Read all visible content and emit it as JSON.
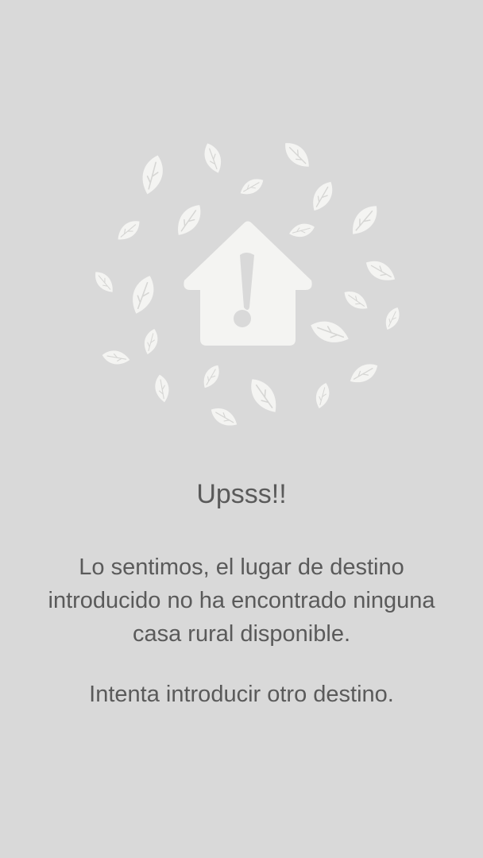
{
  "empty_state": {
    "title": "Upsss!!",
    "message": "Lo sentimos, el lugar de destino introducido no ha encontrado ninguna casa rural disponible.",
    "hint": "Intenta introducir otro destino.",
    "illustration_icon": "house-warning-icon",
    "decoration_icon": "leaf-icon"
  },
  "colors": {
    "background": "#d9d9d9",
    "text": "#5a5a5a",
    "illustration": "#f4f4f2"
  }
}
